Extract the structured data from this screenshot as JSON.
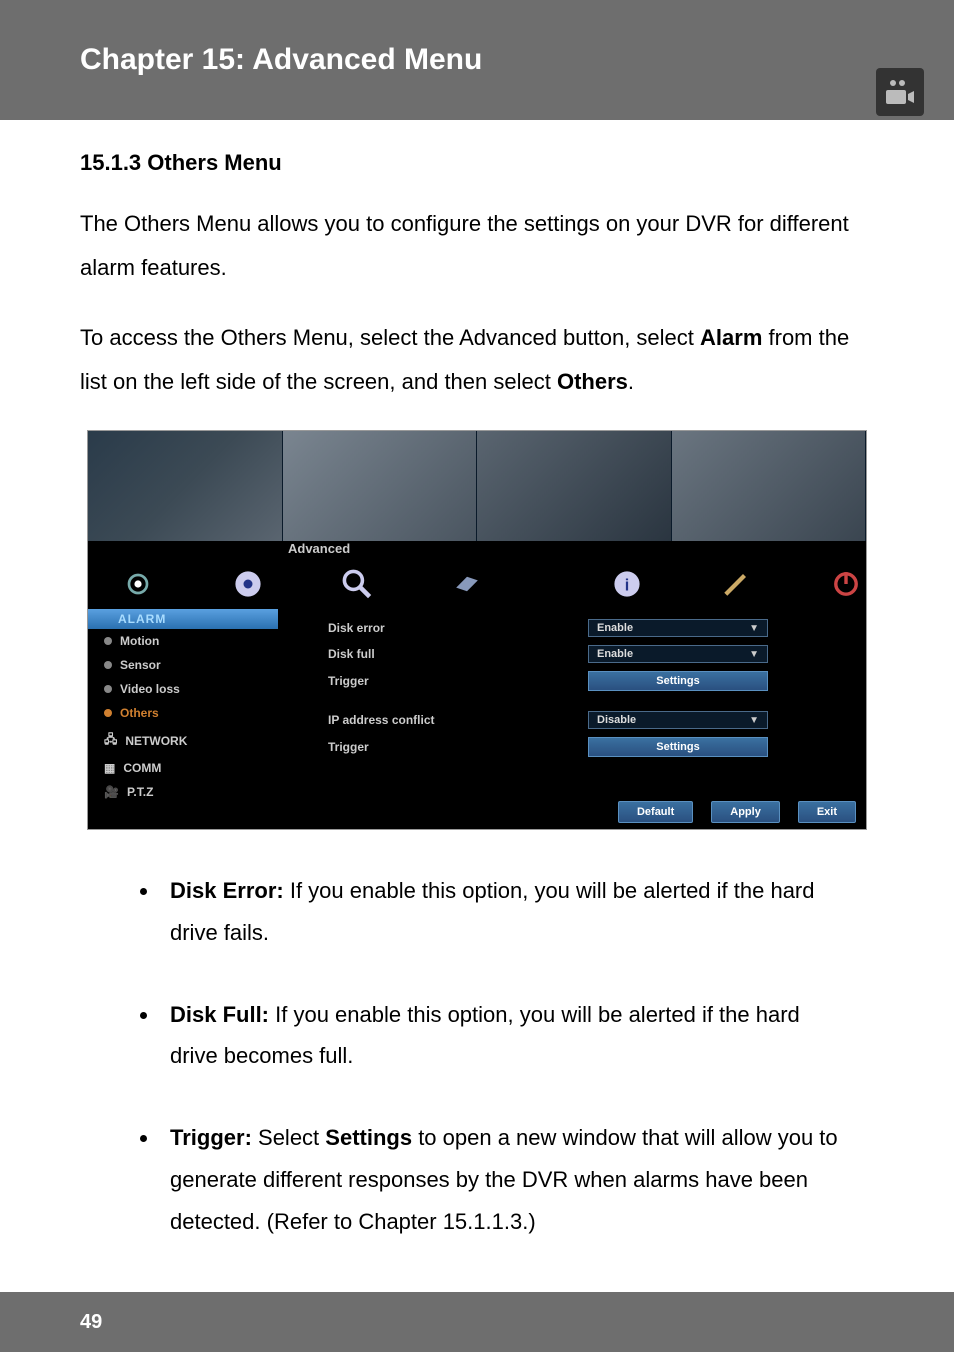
{
  "header": {
    "title": "Chapter 15: Advanced Menu"
  },
  "section": {
    "heading": "15.1.3 Others Menu",
    "intro": "The Others Menu allows you to configure the settings on your DVR for different alarm features.",
    "access_prefix": "To access the Others Menu, select the Advanced button, select ",
    "access_bold1": "Alarm",
    "access_mid": " from the list on the left side of the screen, and then select ",
    "access_bold2": "Others",
    "access_suffix": "."
  },
  "screenshot": {
    "window_title": "Advanced",
    "sidebar": {
      "header": "ALARM",
      "items": [
        "Motion",
        "Sensor",
        "Video loss",
        "Others"
      ],
      "selected": "Others",
      "sections": [
        "NETWORK",
        "COMM",
        "P.T.Z"
      ]
    },
    "rows": {
      "disk_error": {
        "label": "Disk error",
        "value": "Enable"
      },
      "disk_full": {
        "label": "Disk full",
        "value": "Enable"
      },
      "trigger1": {
        "label": "Trigger",
        "button": "Settings"
      },
      "ip_conflict": {
        "label": "IP address conflict",
        "value": "Disable"
      },
      "trigger2": {
        "label": "Trigger",
        "button": "Settings"
      }
    },
    "buttons": {
      "default": "Default",
      "apply": "Apply",
      "exit": "Exit"
    }
  },
  "bullets": {
    "disk_error": {
      "title": "Disk Error:",
      "text": " If you enable this option, you will be alerted if the hard drive fails."
    },
    "disk_full": {
      "title": "Disk Full:",
      "text": " If you enable this option, you will be alerted if the hard drive becomes full."
    },
    "trigger": {
      "title": "Trigger:",
      "text_pre": " Select ",
      "bold": "Settings",
      "text_post": " to open a new window that will allow you to generate different responses by the DVR when alarms have been detected. (Refer to Chapter 15.1.1.3.)"
    }
  },
  "footer": {
    "page": "49"
  }
}
